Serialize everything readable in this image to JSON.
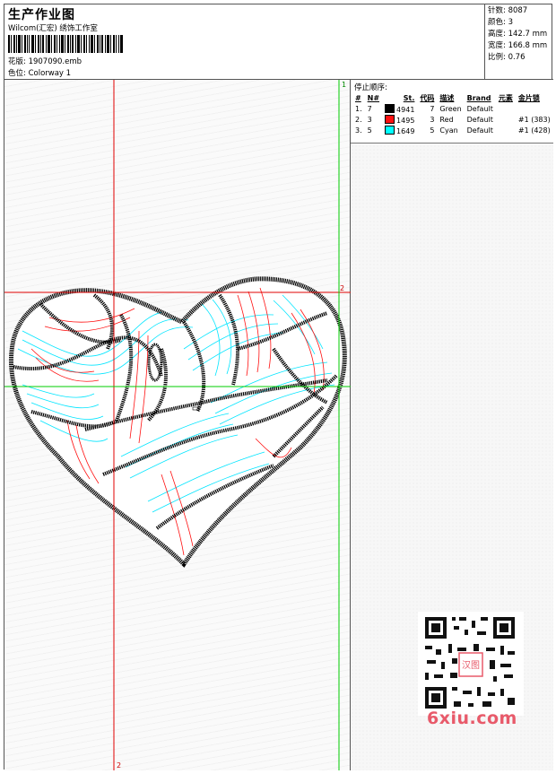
{
  "header": {
    "title": "生产作业图",
    "company": "Wilcom(汇宏) 绣饰工作室",
    "design_label": "花版: 1907090.emb",
    "colorway_label": "色位: Colorway 1"
  },
  "stats": [
    {
      "label": "针数: 8087"
    },
    {
      "label": "颜色: 3"
    },
    {
      "label": "高度: 142.7 mm"
    },
    {
      "label": "宽度: 166.8 mm"
    },
    {
      "label": "比例: 0.76"
    }
  ],
  "stop_sequence": {
    "title": "停止顺序:",
    "columns": [
      "#",
      "N#",
      "St.",
      "代码",
      "描述",
      "Brand",
      "元素",
      "金片锁"
    ],
    "rows": [
      {
        "idx": "1.",
        "needle": "7",
        "color": "#000000",
        "stitches": "4941",
        "code": "7",
        "desc": "Green",
        "brand": "Default",
        "elements": "",
        "sequin": ""
      },
      {
        "idx": "2.",
        "needle": "3",
        "color": "#ff1010",
        "stitches": "1495",
        "code": "3",
        "desc": "Red",
        "brand": "Default",
        "elements": "",
        "sequin": "#1 (383)"
      },
      {
        "idx": "3.",
        "needle": "5",
        "color": "#00ffff",
        "stitches": "1649",
        "code": "5",
        "desc": "Cyan",
        "brand": "Default",
        "elements": "",
        "sequin": "#1 (428)"
      }
    ]
  },
  "guides": {
    "v1": "1",
    "h2": "2",
    "v2": "2"
  },
  "watermark": "6xiu.com",
  "qr_stamp": "汉图",
  "colors": {
    "outline": "#000000",
    "red": "#ff1010",
    "cyan": "#00e5ff",
    "guide_red": "#e00000",
    "guide_green": "#00cc00"
  }
}
